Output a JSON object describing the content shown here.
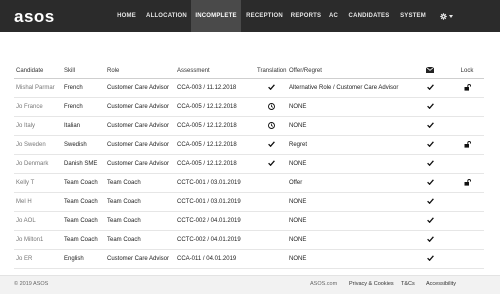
{
  "brand": "asos",
  "nav": [
    {
      "label": "HOME",
      "active": false
    },
    {
      "label": "ALLOCATION",
      "active": false
    },
    {
      "label": "INCOMPLETE",
      "active": true
    },
    {
      "label": "RECEPTION",
      "active": false
    },
    {
      "label": "REPORTS",
      "active": false
    },
    {
      "label": "AC",
      "active": false
    },
    {
      "label": "CANDIDATES",
      "active": false
    },
    {
      "label": "SYSTEM",
      "active": false
    }
  ],
  "table": {
    "headers": {
      "candidate": "Candidate",
      "skill": "Skill",
      "role": "Role",
      "assessment": "Assessment",
      "translation": "Translation",
      "offer": "Offer/Regret",
      "lock": "Lock"
    },
    "rows": [
      {
        "candidate": "Mishal Parmar",
        "skill": "French",
        "role": "Customer Care Advisor",
        "assessment": "CCA-003 / 11.12.2018",
        "translation": "tick",
        "offer": "Alternative Role / Customer Care Advisor",
        "mail": "tick",
        "lock": "unlocked"
      },
      {
        "candidate": "Jo France",
        "skill": "French",
        "role": "Customer Care Advisor",
        "assessment": "CCA-005 / 12.12.2018",
        "translation": "clock",
        "offer": "NONE",
        "mail": "tick",
        "lock": ""
      },
      {
        "candidate": "Jo Italy",
        "skill": "Italian",
        "role": "Customer Care Advisor",
        "assessment": "CCA-005 / 12.12.2018",
        "translation": "clock",
        "offer": "NONE",
        "mail": "tick",
        "lock": ""
      },
      {
        "candidate": "Jo Sweden",
        "skill": "Swedish",
        "role": "Customer Care Advisor",
        "assessment": "CCA-005 / 12.12.2018",
        "translation": "tick",
        "offer": "Regret",
        "mail": "tick",
        "lock": "unlocked"
      },
      {
        "candidate": "Jo Denmark",
        "skill": "Danish SME",
        "role": "Customer Care Advisor",
        "assessment": "CCA-005 / 12.12.2018",
        "translation": "tick",
        "offer": "NONE",
        "mail": "tick",
        "lock": ""
      },
      {
        "candidate": "Kelly T",
        "skill": "Team Coach",
        "role": "Team Coach",
        "assessment": "CCTC-001 / 03.01.2019",
        "translation": "",
        "offer": "Offer",
        "mail": "tick",
        "lock": "unlocked"
      },
      {
        "candidate": "Mel H",
        "skill": "Team Coach",
        "role": "Team Coach",
        "assessment": "CCTC-001 / 03.01.2019",
        "translation": "",
        "offer": "NONE",
        "mail": "tick",
        "lock": ""
      },
      {
        "candidate": "Jo AOL",
        "skill": "Team Coach",
        "role": "Team Coach",
        "assessment": "CCTC-002 / 04.01.2019",
        "translation": "",
        "offer": "NONE",
        "mail": "tick",
        "lock": ""
      },
      {
        "candidate": "Jo Milton1",
        "skill": "Team Coach",
        "role": "Team Coach",
        "assessment": "CCTC-002 / 04.01.2019",
        "translation": "",
        "offer": "NONE",
        "mail": "tick",
        "lock": ""
      },
      {
        "candidate": "Jo ER",
        "skill": "English",
        "role": "Customer Care Advisor",
        "assessment": "CCA-011 / 04.01.2019",
        "translation": "",
        "offer": "NONE",
        "mail": "tick",
        "lock": ""
      }
    ]
  },
  "footer": {
    "copyright": "© 2019 ASOS",
    "site": "ASOS.com",
    "privacy": "Privacy & Cookies",
    "terms": "T&Cs",
    "accessibility": "Accessibility"
  }
}
